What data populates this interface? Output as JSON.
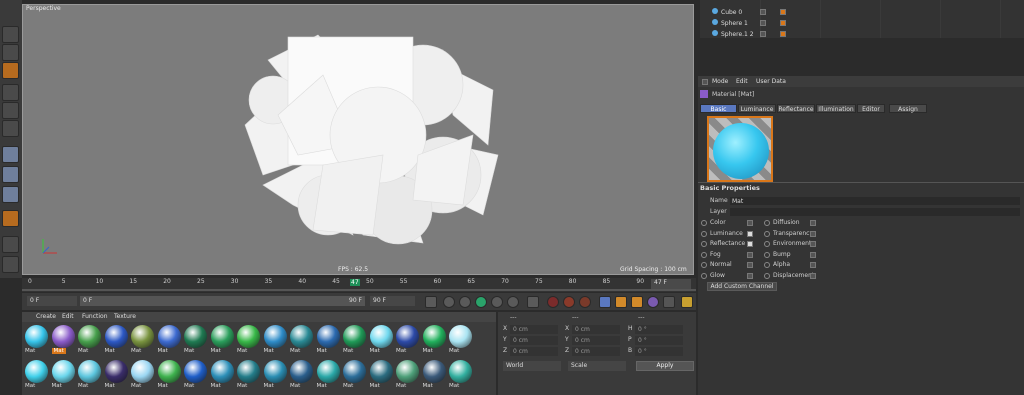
{
  "viewport": {
    "label": "Perspective",
    "fps": "FPS : 62.5",
    "grid": "Grid Spacing : 100 cm"
  },
  "timeline": {
    "ticks": [
      "0",
      "5",
      "10",
      "15",
      "20",
      "25",
      "30",
      "35",
      "40",
      "45",
      "50",
      "55",
      "60",
      "65",
      "70",
      "75",
      "80",
      "85",
      "90"
    ],
    "playhead": "47",
    "frame_display": "47 F"
  },
  "transport": {
    "start_field": "0 F",
    "min_field": "0 F",
    "max_field": "90 F",
    "end_field": "90 F"
  },
  "material_manager": {
    "menu": [
      "Create",
      "Edit",
      "Function",
      "Texture"
    ],
    "materials": [
      {
        "label": "Mat",
        "color": "#36c4ea"
      },
      {
        "label": "Mat",
        "color": "#8a5bc9",
        "selected": true
      },
      {
        "label": "Mat",
        "color": "#47a04c"
      },
      {
        "label": "Mat",
        "color": "#2c58c4"
      },
      {
        "label": "Mat",
        "color": "#79933f"
      },
      {
        "label": "Mat",
        "color": "#3c6ad0"
      },
      {
        "label": "Mat",
        "color": "#1f7a52"
      },
      {
        "label": "Mat",
        "color": "#2a9e5b"
      },
      {
        "label": "Mat",
        "color": "#38b848"
      },
      {
        "label": "Mat",
        "color": "#2e8cc8"
      },
      {
        "label": "Mat",
        "color": "#2a8a95"
      },
      {
        "label": "Mat",
        "color": "#2b6ab0"
      },
      {
        "label": "Mat",
        "color": "#1f9a57"
      },
      {
        "label": "Mat",
        "color": "#6fd8ee"
      },
      {
        "label": "Mat",
        "color": "#2c4aa8"
      },
      {
        "label": "Mat",
        "color": "#21b05c"
      },
      {
        "label": "Mat",
        "color": "#a9e4f2"
      },
      {
        "label": "Mat",
        "color": "#3fd0ea"
      },
      {
        "label": "Mat",
        "color": "#6ad6ec"
      },
      {
        "label": "Mat",
        "color": "#5cc6de"
      },
      {
        "label": "Mat",
        "color": "#3a2d6a"
      },
      {
        "label": "Mat",
        "color": "#9ad6f2"
      },
      {
        "label": "Mat",
        "color": "#3eb24e"
      },
      {
        "label": "Mat",
        "color": "#1f5ec8"
      },
      {
        "label": "Mat",
        "color": "#2c8fb8"
      },
      {
        "label": "Mat",
        "color": "#237d8a"
      },
      {
        "label": "Mat",
        "color": "#2a8eb3"
      },
      {
        "label": "Mat",
        "color": "#2a5e8c"
      },
      {
        "label": "Mat",
        "color": "#2aa8a8"
      },
      {
        "label": "Mat",
        "color": "#2c6e9a"
      },
      {
        "label": "Mat",
        "color": "#2b6c80"
      },
      {
        "label": "Mat",
        "color": "#4ea07a"
      },
      {
        "label": "Mat",
        "color": "#3b5a7a"
      },
      {
        "label": "Mat",
        "color": "#33b0a0"
      }
    ]
  },
  "coordinates": {
    "headers": [
      "---",
      "---",
      "---"
    ],
    "rows": [
      {
        "a": "X",
        "av": "0 cm",
        "b": "X",
        "bv": "0 cm",
        "c": "H",
        "cv": "0 °"
      },
      {
        "a": "Y",
        "av": "0 cm",
        "b": "Y",
        "bv": "0 cm",
        "c": "P",
        "cv": "0 °"
      },
      {
        "a": "Z",
        "av": "0 cm",
        "b": "Z",
        "bv": "0 cm",
        "c": "B",
        "cv": "0 °"
      }
    ],
    "mode_dropdown": "World",
    "scale_dropdown": "Scale",
    "apply": "Apply"
  },
  "objects": [
    "Cube 0",
    "Sphere 1",
    "Sphere.1 2"
  ],
  "attributes": {
    "menu": [
      "Mode",
      "Edit",
      "User Data"
    ],
    "title": "Material [Mat]",
    "tabs": [
      "Basic",
      "Luminance",
      "Reflectance",
      "Illumination",
      "Editor",
      "Assign"
    ],
    "section": "Basic Properties",
    "name_label": "Name",
    "name_value": "Mat",
    "layer_label": "Layer",
    "channels_left": [
      "Color",
      "Luminance",
      "Reflectance",
      "Fog",
      "Normal",
      "Glow"
    ],
    "channels_right": [
      "Diffusion",
      "Transparency",
      "Environment",
      "Bump",
      "Alpha",
      "Displacement"
    ],
    "checked_left": [
      "Luminance",
      "Reflectance"
    ],
    "add_channel": "Add Custom Channel"
  }
}
